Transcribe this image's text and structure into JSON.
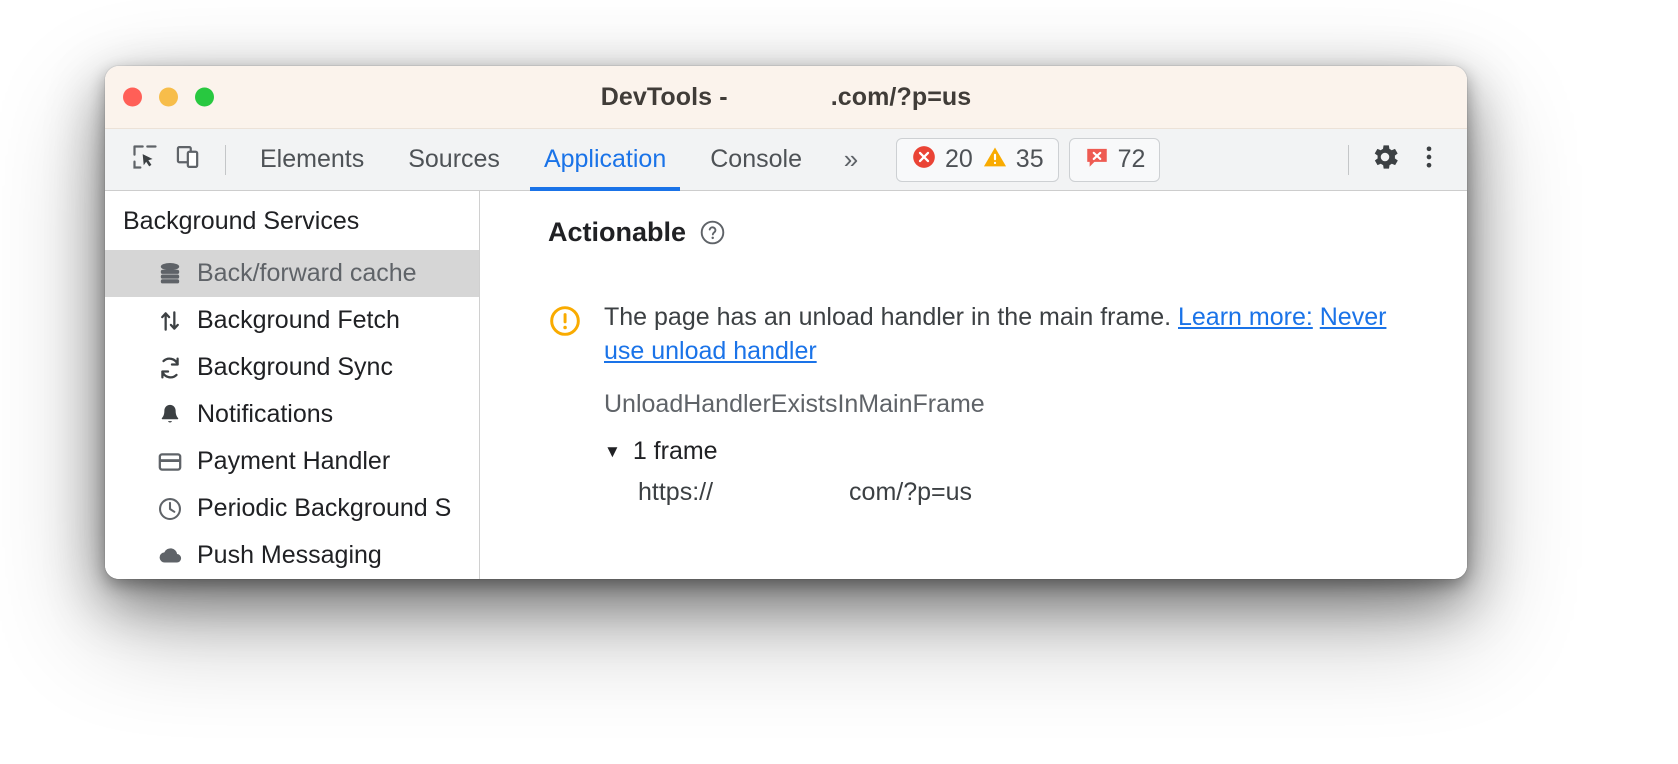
{
  "window": {
    "title_prefix": "DevTools - ",
    "title_suffix": ".com/?p=us",
    "traffic_lights": {
      "close": "close-window",
      "minimize": "minimize-window",
      "maximize": "maximize-window"
    }
  },
  "toolbar": {
    "inspect_icon": "inspect-element-icon",
    "device_toolbar_icon": "device-toolbar-icon",
    "tabs": [
      {
        "label": "Elements",
        "active": false
      },
      {
        "label": "Sources",
        "active": false
      },
      {
        "label": "Application",
        "active": true
      },
      {
        "label": "Console",
        "active": false
      }
    ],
    "more_tabs_label": "»",
    "errors": {
      "icon": "error-circle-icon",
      "count": "20",
      "color": "#ea4335"
    },
    "warnings": {
      "icon": "warning-triangle-icon",
      "count": "35",
      "color": "#f9ab00"
    },
    "issues": {
      "icon": "issue-message-icon",
      "count": "72",
      "color": "#ee5b52"
    },
    "settings_icon": "gear-icon",
    "more_options_icon": "kebab-menu-icon"
  },
  "sidebar": {
    "title": "Background Services",
    "items": [
      {
        "label": "Back/forward cache",
        "icon": "database-icon",
        "selected": true
      },
      {
        "label": "Background Fetch",
        "icon": "arrows-up-down-icon",
        "selected": false
      },
      {
        "label": "Background Sync",
        "icon": "sync-refresh-icon",
        "selected": false
      },
      {
        "label": "Notifications",
        "icon": "bell-icon",
        "selected": false
      },
      {
        "label": "Payment Handler",
        "icon": "credit-card-icon",
        "selected": false
      },
      {
        "label": "Periodic Background S",
        "icon": "clock-icon",
        "selected": false
      },
      {
        "label": "Push Messaging",
        "icon": "cloud-icon",
        "selected": false
      }
    ]
  },
  "main": {
    "section_title": "Actionable",
    "help_icon": "question-mark-circle-icon",
    "issue": {
      "icon": "warning-exclamation-circle-icon",
      "message": "The page has an unload handler in the main frame. ",
      "learn_more_label": "Learn more:",
      "learn_more_link": "Never use unload handler",
      "reason_code": "UnloadHandlerExistsInMainFrame"
    },
    "frames": {
      "caret": "▼",
      "toggle_label": "1 frame",
      "url_prefix": "https://",
      "url_suffix": "com/?p=us",
      "highlight_color": "#1464e6"
    }
  }
}
